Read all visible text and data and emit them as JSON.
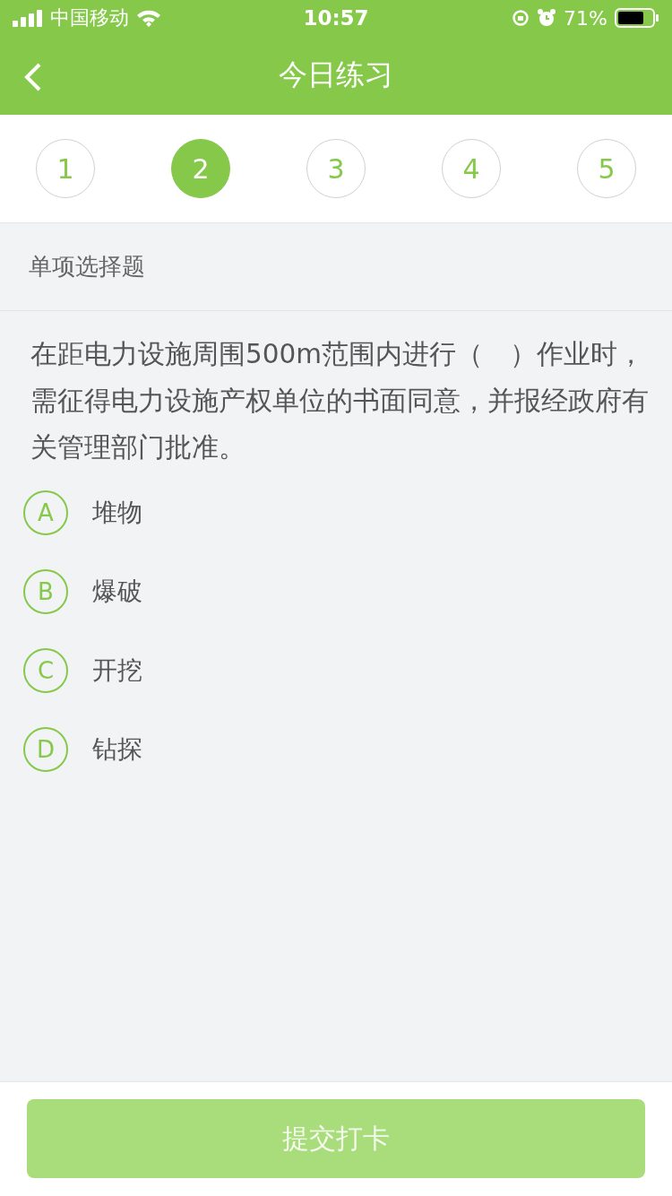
{
  "status_bar": {
    "carrier": "中国移动",
    "time": "10:57",
    "battery": "71%"
  },
  "nav": {
    "title": "今日练习"
  },
  "steps": [
    {
      "label": "1",
      "selected": false
    },
    {
      "label": "2",
      "selected": true
    },
    {
      "label": "3",
      "selected": false
    },
    {
      "label": "4",
      "selected": false
    },
    {
      "label": "5",
      "selected": false
    }
  ],
  "section": {
    "title": "单项选择题"
  },
  "question": {
    "text": "在距电力设施周围500m范围内进行（　）作业时，需征得电力设施产权单位的书面同意，并报经政府有关管理部门批准。"
  },
  "options": [
    {
      "letter": "A",
      "text": "堆物"
    },
    {
      "letter": "B",
      "text": "爆破"
    },
    {
      "letter": "C",
      "text": "开挖"
    },
    {
      "letter": "D",
      "text": "钻探"
    }
  ],
  "submit": {
    "label": "提交打卡",
    "disabled": true
  }
}
